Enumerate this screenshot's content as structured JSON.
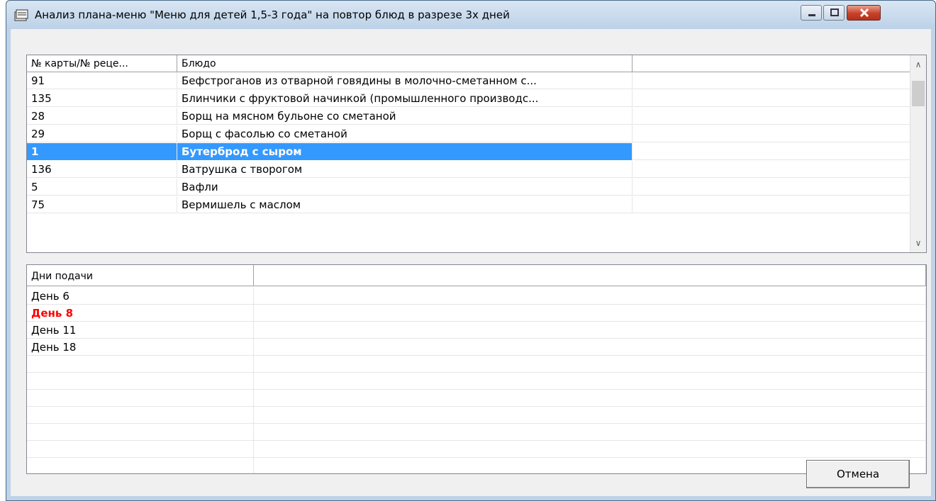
{
  "window": {
    "title": "Анализ плана-меню \"Меню для детей 1,5-3 года\" на повтор блюд в разрезе 3х дней"
  },
  "dishes_table": {
    "columns": [
      "№ карты/№ реце...",
      "Блюдо",
      ""
    ],
    "rows": [
      {
        "card": "91",
        "dish": "Бефстроганов из отварной говядины в молочно-сметанном с..."
      },
      {
        "card": "135",
        "dish": "Блинчики с фруктовой начинкой (промышленного производс..."
      },
      {
        "card": "28",
        "dish": "Борщ на мясном бульоне со сметаной"
      },
      {
        "card": "29",
        "dish": "Борщ с фасолью со сметаной"
      },
      {
        "card": "1",
        "dish": "Бутерброд с сыром",
        "selected": true
      },
      {
        "card": "136",
        "dish": "Ватрушка с творогом"
      },
      {
        "card": "5",
        "dish": "Вафли"
      },
      {
        "card": "75",
        "dish": "Вермишель с маслом"
      }
    ]
  },
  "days_table": {
    "columns": [
      "Дни подачи",
      ""
    ],
    "rows": [
      {
        "day": "День 6",
        "highlight": false
      },
      {
        "day": "День 8",
        "highlight": true
      },
      {
        "day": "День 11",
        "highlight": false
      },
      {
        "day": "День 18",
        "highlight": false
      }
    ]
  },
  "buttons": {
    "cancel": "Отмена"
  },
  "colors": {
    "selection": "#3399ff",
    "highlight_text": "#ff0000"
  }
}
